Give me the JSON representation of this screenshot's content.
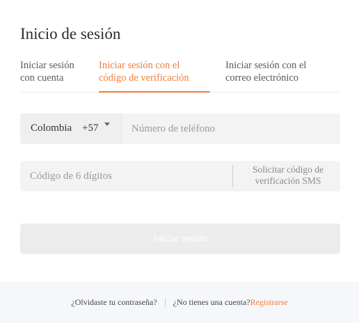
{
  "dialog": {
    "title": "Inicio de sesión"
  },
  "tabs": [
    {
      "label_line1": "Iniciar sesión",
      "label_line2": "con cuenta",
      "active": false
    },
    {
      "label_line1": "Iniciar sesión con el",
      "label_line2": "código de verificación",
      "active": true
    },
    {
      "label_line1": "Iniciar sesión con el",
      "label_line2": "correo electrónico",
      "active": false
    }
  ],
  "phone": {
    "country_name": "Colombia",
    "country_code": "+57",
    "placeholder": "Número de teléfono",
    "value": ""
  },
  "code": {
    "placeholder": "Código de 6 dígitos",
    "value": "",
    "send_label_line1": "Solicitar código de",
    "send_label_line2": "verificación SMS"
  },
  "login_button": {
    "label": "Iniciar sesión"
  },
  "footer": {
    "forgot_password": "¿Olvidaste tu contraseña?",
    "no_account": "¿No tienes una cuenta?",
    "register": "Registrarse"
  },
  "colors": {
    "accent": "#f07c3f",
    "field_bg": "#f3f3f4",
    "button_disabled_bg": "#ececec",
    "footer_bg": "#f6f7fa"
  }
}
